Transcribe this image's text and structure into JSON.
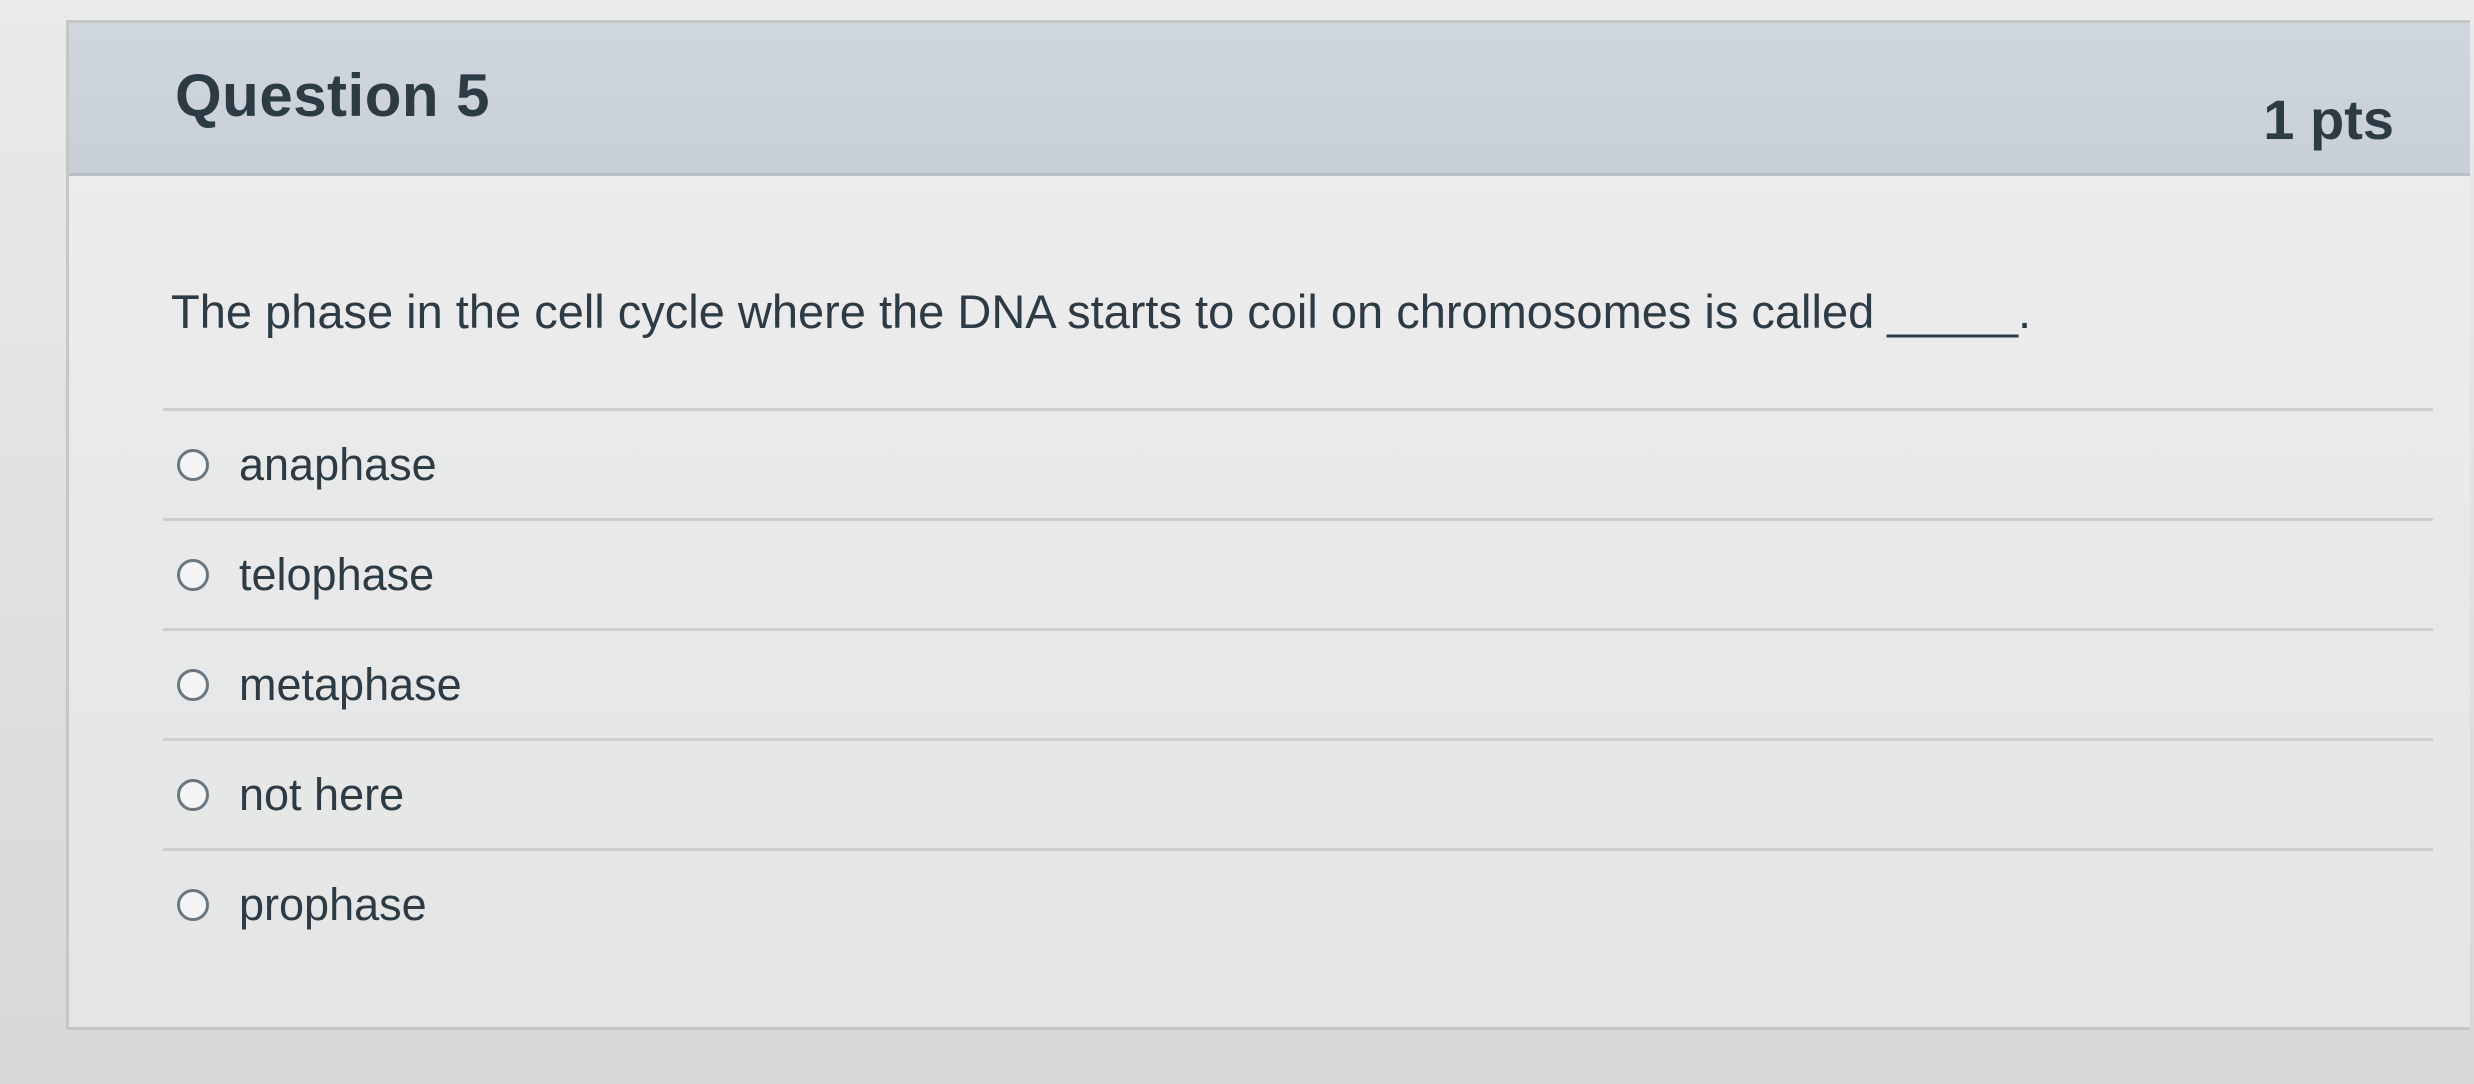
{
  "question": {
    "title": "Question 5",
    "points": "1 pts",
    "text": "The phase in the cell cycle where the DNA starts to coil on chromosomes is called _____.",
    "answers": [
      {
        "label": "anaphase",
        "selected": false
      },
      {
        "label": "telophase",
        "selected": false
      },
      {
        "label": "metaphase",
        "selected": false
      },
      {
        "label": "not here",
        "selected": false
      },
      {
        "label": "prophase",
        "selected": false
      }
    ]
  },
  "colors": {
    "header_bg": "#c9cfd7",
    "text": "#2d3b45",
    "divider": "#cbcfd1"
  }
}
